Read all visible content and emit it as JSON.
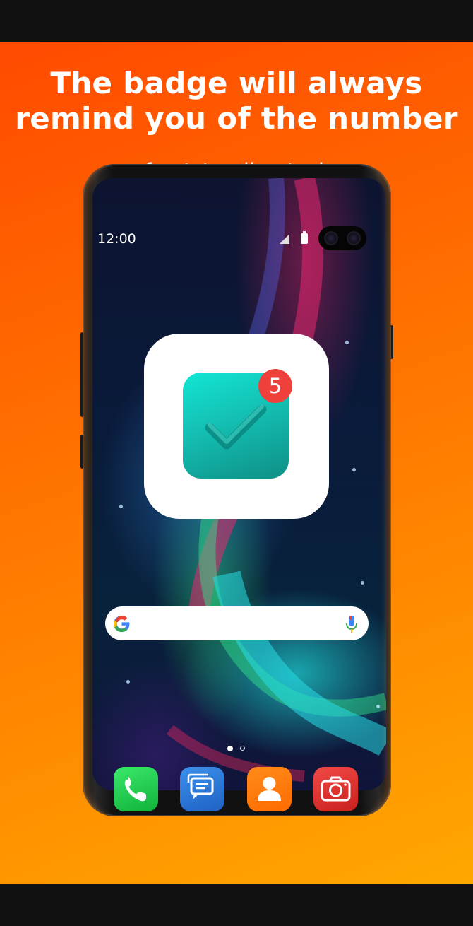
{
  "promo": {
    "headline_line1": "The badge will always",
    "headline_line2": "remind you of the number",
    "subline": "of outstanding tasks",
    "background_colors": [
      "#ff4a00",
      "#ffa800"
    ]
  },
  "status_bar": {
    "time": "12:00",
    "icons": [
      "signal-icon",
      "battery-icon"
    ]
  },
  "app_icon": {
    "icon": "checkmark-icon",
    "badge_count": "5",
    "badge_color": "#f0403c",
    "icon_color": "#14bfb3"
  },
  "search_bar": {
    "icons": [
      "google-g-icon",
      "microphone-icon"
    ]
  },
  "page_indicator": {
    "pages": 2,
    "active_page": 1
  },
  "dock": {
    "apps": [
      {
        "name": "phone",
        "icon": "phone-icon",
        "color": "#1fc24a"
      },
      {
        "name": "messages",
        "icon": "messages-icon",
        "color": "#2a78d8"
      },
      {
        "name": "contacts",
        "icon": "contacts-icon",
        "color": "#ff7a00"
      },
      {
        "name": "camera",
        "icon": "camera-icon",
        "color": "#e0312f"
      }
    ]
  }
}
